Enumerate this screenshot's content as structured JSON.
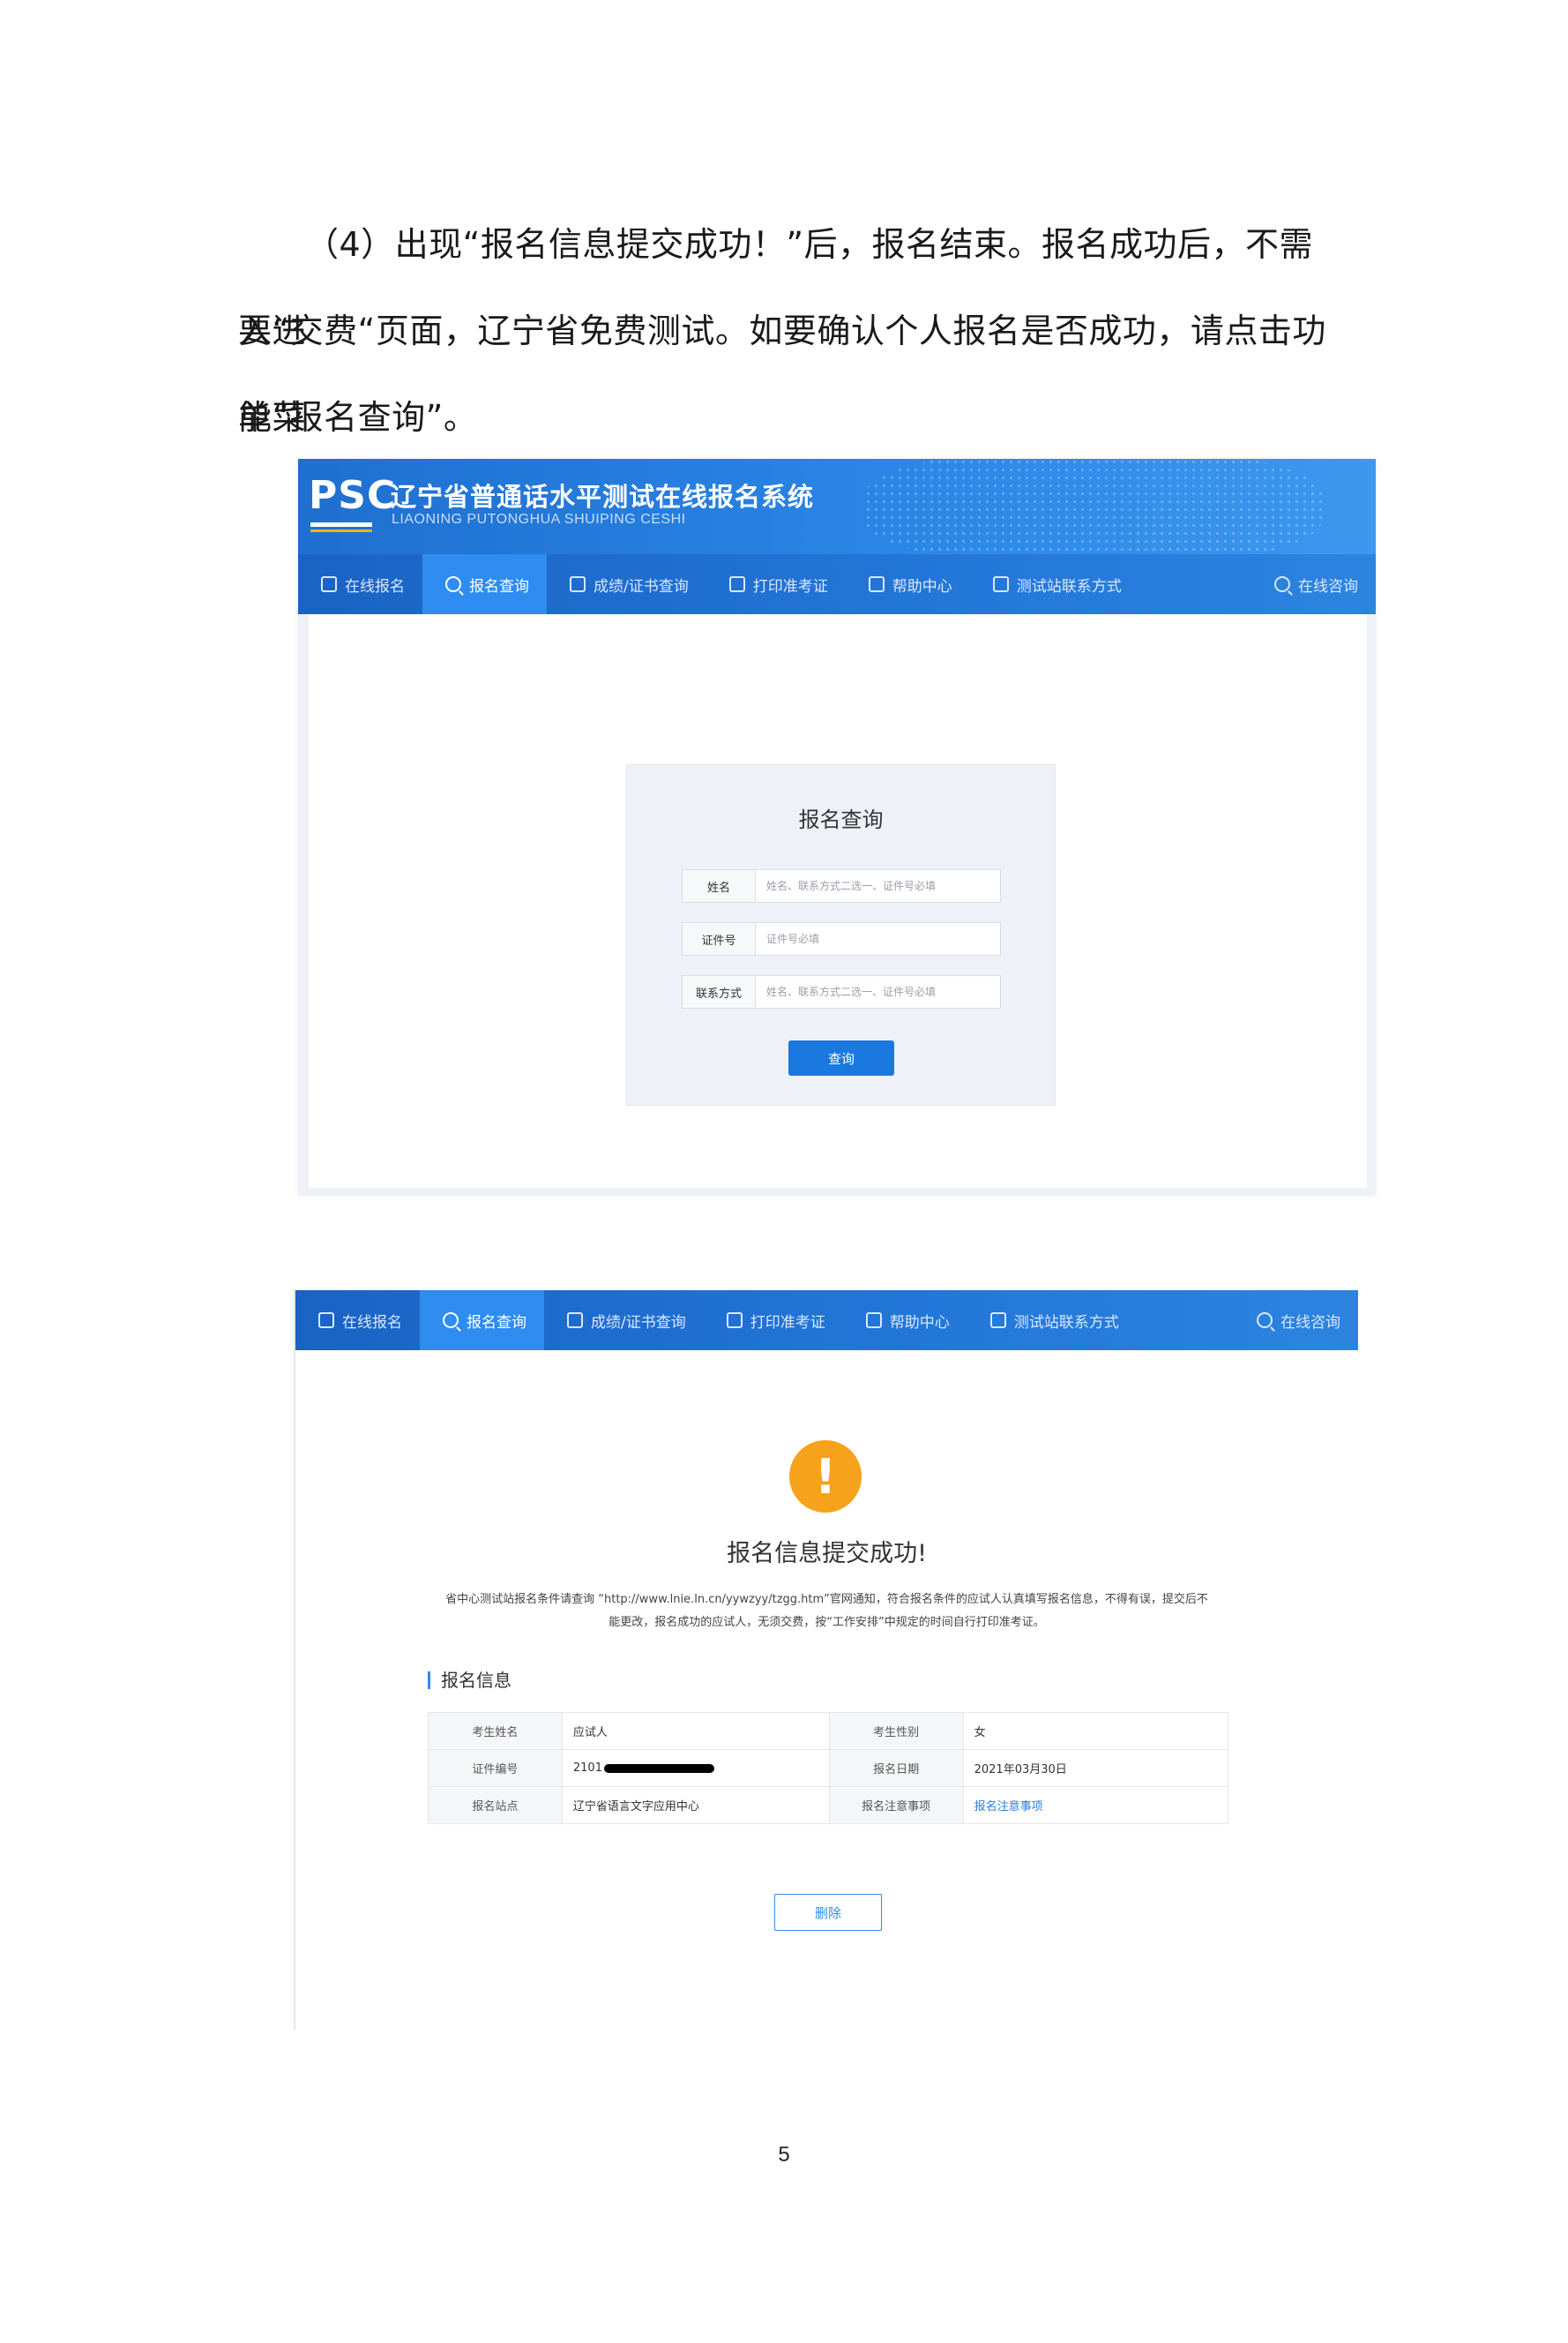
{
  "paragraph": {
    "line1": "（4）出现“报名信息提交成功！”后，报名结束。报名成功后，不需要进",
    "line2": "入“交费“页面，辽宁省免费测试。如要确认个人报名是否成功，请点击功能菜",
    "line3": "单“报名查询”。"
  },
  "screenshot1": {
    "logo": "PSC",
    "system_title": "辽宁省普通话水平测试在线报名系统",
    "system_subtitle": "LIAONING PUTONGHUA SHUIPING CESHI",
    "nav": {
      "items": [
        {
          "label": "在线报名",
          "icon": "edit-icon"
        },
        {
          "label": "报名查询",
          "icon": "search-icon",
          "active": true
        },
        {
          "label": "成绩/证书查询",
          "icon": "certificate-search-icon"
        },
        {
          "label": "打印准考证",
          "icon": "printer-icon"
        },
        {
          "label": "帮助中心",
          "icon": "help-icon"
        },
        {
          "label": "测试站联系方式",
          "icon": "phone-icon"
        }
      ],
      "right": {
        "label": "在线咨询",
        "icon": "chat-icon"
      }
    },
    "query": {
      "title": "报名查询",
      "fields": [
        {
          "label": "姓名",
          "placeholder": "姓名、联系方式二选一、证件号必填"
        },
        {
          "label": "证件号",
          "placeholder": "证件号必填"
        },
        {
          "label": "联系方式",
          "placeholder": "姓名、联系方式二选一、证件号必填"
        }
      ],
      "button": "查询"
    }
  },
  "screenshot2": {
    "nav": {
      "items": [
        {
          "label": "在线报名",
          "icon": "edit-icon"
        },
        {
          "label": "报名查询",
          "icon": "search-icon",
          "active": true
        },
        {
          "label": "成绩/证书查询",
          "icon": "certificate-search-icon"
        },
        {
          "label": "打印准考证",
          "icon": "printer-icon"
        },
        {
          "label": "帮助中心",
          "icon": "help-icon"
        },
        {
          "label": "测试站联系方式",
          "icon": "phone-icon"
        }
      ],
      "right": {
        "label": "在线咨询",
        "icon": "chat-icon"
      }
    },
    "warning_symbol": "!",
    "success_title": "报名信息提交成功!",
    "notice_line1": "省中心测试站报名条件请查询 “http://www.lnie.ln.cn/yywzyy/tzgg.htm”官网通知，符合报名条件的应试人认真填写报名信息，不得有误，提交后不",
    "notice_line2": "能更改，报名成功的应试人，无须交费，按“工作安排”中规定的时间自行打印准考证。",
    "section_label": "报名信息",
    "info": {
      "name_label": "考生姓名",
      "name_value": "应试人",
      "gender_label": "考生性别",
      "gender_value": "女",
      "id_label": "证件编号",
      "id_value": "2101",
      "date_label": "报名日期",
      "date_value": "2021年03月30日",
      "site_label": "报名站点",
      "site_value": "辽宁省语言文字应用中心",
      "notes_label": "报名注意事项",
      "notes_value": "报名注意事项"
    },
    "delete_button": "删除"
  },
  "page_number": "5",
  "colors": {
    "nav_blue": "#2377d8",
    "active_tab": "#2f8cf0",
    "warning_orange": "#f7a21b",
    "link_blue": "#2a7de1"
  }
}
